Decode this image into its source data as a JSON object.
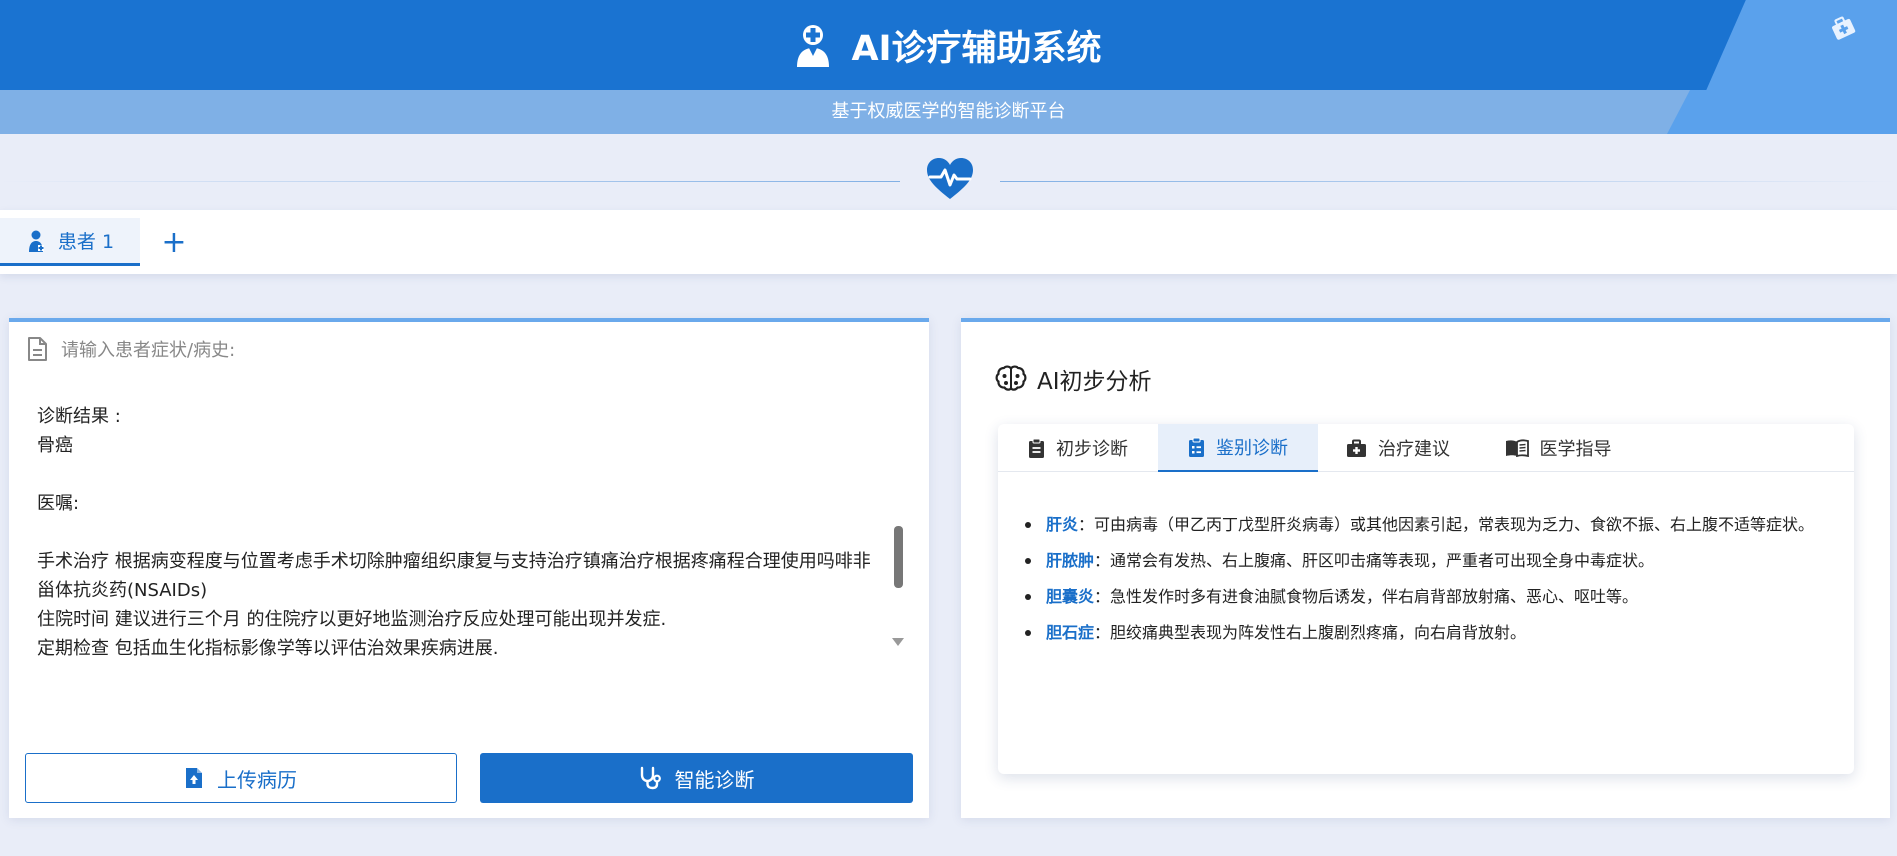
{
  "header": {
    "title": "AI诊疗辅助系统",
    "subtitle": "基于权威医学的智能诊断平台",
    "logo_icon": "doctor-icon",
    "corner_icon": "medkit-icon"
  },
  "divider": {
    "icon": "heartbeat-icon"
  },
  "patients": {
    "tabs": [
      {
        "label": "患者 1",
        "icon": "patient-icon"
      }
    ],
    "add_label": "+"
  },
  "input_panel": {
    "label": "请输入患者症状/病史:",
    "label_icon": "document-icon",
    "text_content": "诊断结果 :\n骨癌\n\n医嘱:\n\n手术治疗 根据病变程度与位置考虑手术切除肿瘤组织康复与支持治疗镇痛治疗根据疼痛程合理使用吗啡非甾体抗炎药(NSAIDs)\n住院时间 建议进行三个月 的住院疗以更好地监测治疗反应处理可能出现并发症.\n定期检查 包括血生化指标影像学等以评估治效果疾病进展.",
    "upload_button": "上传病历",
    "upload_icon": "upload-file-icon",
    "diagnose_button": "智能诊断",
    "diagnose_icon": "stethoscope-icon"
  },
  "analysis_panel": {
    "title": "AI初步分析",
    "title_icon": "brain-icon",
    "tabs": [
      {
        "label": "初步诊断",
        "icon": "clipboard-icon",
        "active": false
      },
      {
        "label": "鉴别诊断",
        "icon": "checklist-icon",
        "active": true
      },
      {
        "label": "治疗建议",
        "icon": "medical-bag-icon",
        "active": false
      },
      {
        "label": "医学指导",
        "icon": "book-icon",
        "active": false
      }
    ],
    "differential": [
      {
        "term": "肝炎",
        "desc": "：可由病毒（甲乙丙丁戊型肝炎病毒）或其他因素引起，常表现为乏力、食欲不振、右上腹不适等症状。"
      },
      {
        "term": "肝脓肿",
        "desc": "：通常会有发热、右上腹痛、肝区叩击痛等表现，严重者可出现全身中毒症状。"
      },
      {
        "term": "胆囊炎",
        "desc": "：急性发作时多有进食油腻食物后诱发，伴右肩背部放射痛、恶心、呕吐等。"
      },
      {
        "term": "胆石症",
        "desc": "：胆绞痛典型表现为阵发性右上腹剧烈疼痛，向右肩背放射。"
      }
    ]
  },
  "colors": {
    "primary": "#1a73d1",
    "primary_dark": "#1a6fc9",
    "subheader": "#7fb0e6",
    "page_bg": "#e9edf8"
  }
}
